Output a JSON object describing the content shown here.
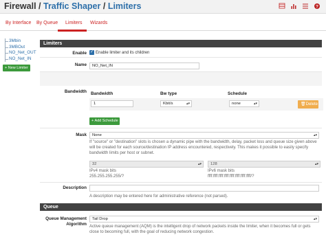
{
  "breadcrumb": {
    "root": "Firewall",
    "sep1": "/",
    "section": "Traffic Shaper",
    "sep2": "/",
    "page": "Limiters"
  },
  "header_icons": [
    "flag-icon",
    "chart-icon",
    "list-icon",
    "help-icon"
  ],
  "tabs": [
    {
      "label": "By Interface",
      "active": false
    },
    {
      "label": "By Queue",
      "active": false
    },
    {
      "label": "Limiters",
      "active": true
    },
    {
      "label": "Wizards",
      "active": false
    }
  ],
  "tree": {
    "items": [
      "3Mbin",
      "3MBOut",
      "NO_Net_OUT",
      "NO_Net_IN"
    ],
    "new_button": "New Limiter"
  },
  "limiters": {
    "heading": "Limiters",
    "enable": {
      "label": "Enable",
      "checked": true,
      "text": "Enable limiter and its children"
    },
    "name": {
      "label": "Name",
      "value": "NO_Net_IN"
    },
    "bandwidth": {
      "label": "Bandwidth",
      "col_bandwidth": "Bandwidth",
      "col_bwtype": "Bw type",
      "col_schedule": "Schedule",
      "value": "1",
      "bwtype": "Kbit/s",
      "schedule": "none",
      "delete_label": "Delete",
      "add_label": "Add Schedule"
    },
    "mask": {
      "label": "Mask",
      "value": "None",
      "hint": "If \"source\" or \"destination\" slots is chosen a dynamic pipe with the bandwidth, delay, packet loss and queue size given above will be created for each source/destination IP address encountered, respectively. This makes it possible to easily specify bandwidth limits per host or subnet.",
      "ipv4_value": "32",
      "ipv4_label": "IPv4 mask bits",
      "ipv4_mask": "255.255.255.255/?",
      "ipv6_value": "128",
      "ipv6_label": "IPv6 mask bits",
      "ipv6_mask": "ffff:ffff:ffff:ffff:ffff:ffff:ffff:ffff/?"
    },
    "description": {
      "label": "Description",
      "value": "",
      "hint": "A description may be entered here for administrative reference (not parsed)."
    }
  },
  "queue": {
    "heading": "Queue",
    "qm_label_line1": "Queue Management",
    "qm_label_line2": "Algorithm",
    "qm_value": "Tail Drop",
    "qm_hint": "Active queue management (AQM) is the intelligent drop of network packets inside the limiter, when it becomes full or gets close to becoming full, with the goal of reducing network congestion."
  },
  "colors": {
    "accent": "#2d6fa9",
    "active_tab": "#cc2222",
    "panel_header": "#424242",
    "success": "#3c9a3c",
    "warning": "#f0ad4e"
  }
}
